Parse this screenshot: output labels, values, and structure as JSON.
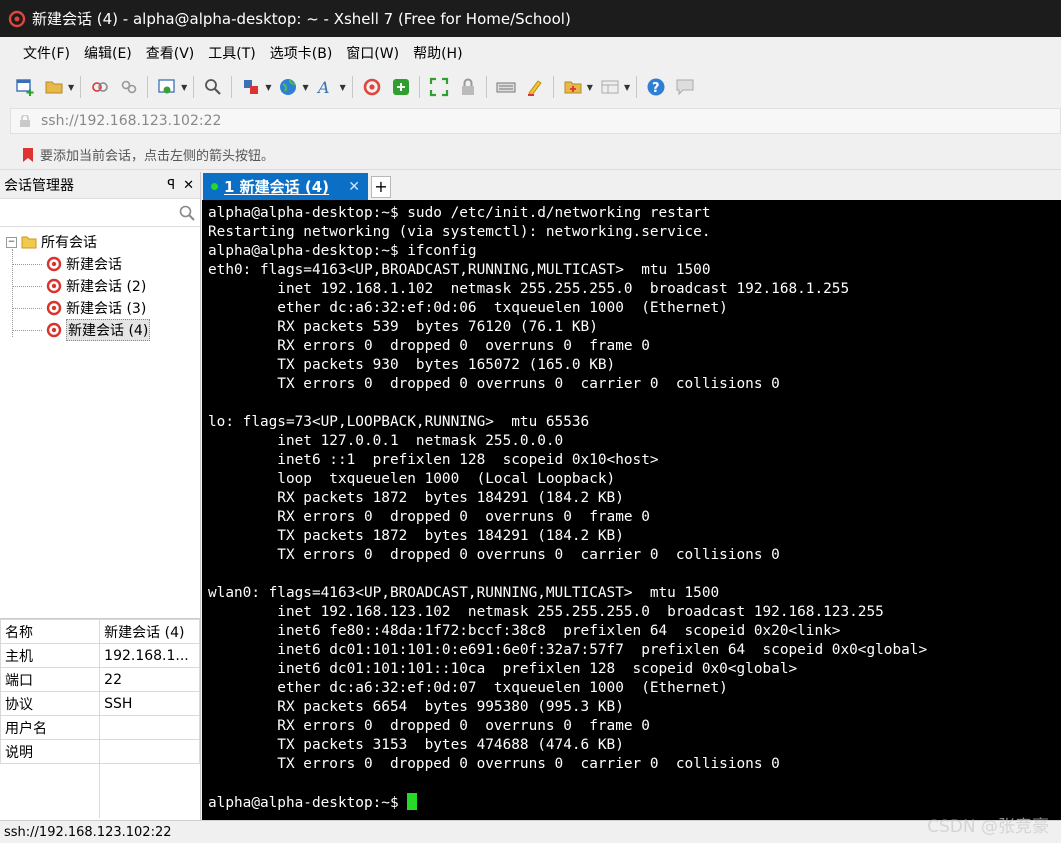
{
  "window": {
    "title": "新建会话 (4) - alpha@alpha-desktop: ~ - Xshell 7 (Free for Home/School)"
  },
  "menu": [
    "文件(F)",
    "编辑(E)",
    "查看(V)",
    "工具(T)",
    "选项卡(B)",
    "窗口(W)",
    "帮助(H)"
  ],
  "address": {
    "value": "ssh://192.168.123.102:22"
  },
  "hint": {
    "text": "要添加当前会话，点击左侧的箭头按钮。"
  },
  "session_manager": {
    "title": "会话管理器",
    "pin": "ꟼ",
    "close": "✕",
    "search_placeholder": "",
    "root": {
      "label": "所有会话",
      "expand": "−"
    },
    "items": [
      "新建会话",
      "新建会话 (2)",
      "新建会话 (3)",
      "新建会话 (4)"
    ]
  },
  "properties": [
    {
      "key": "名称",
      "value": "新建会话 (4)"
    },
    {
      "key": "主机",
      "value": "192.168.1..."
    },
    {
      "key": "端口",
      "value": "22"
    },
    {
      "key": "协议",
      "value": "SSH"
    },
    {
      "key": "用户名",
      "value": ""
    },
    {
      "key": "说明",
      "value": ""
    }
  ],
  "tabs": {
    "active": "1 新建会话 (4)",
    "close": "✕",
    "add": "+"
  },
  "terminal": {
    "lines": [
      "alpha@alpha-desktop:~$ sudo /etc/init.d/networking restart",
      "Restarting networking (via systemctl): networking.service.",
      "alpha@alpha-desktop:~$ ifconfig",
      "eth0: flags=4163<UP,BROADCAST,RUNNING,MULTICAST>  mtu 1500",
      "        inet 192.168.1.102  netmask 255.255.255.0  broadcast 192.168.1.255",
      "        ether dc:a6:32:ef:0d:06  txqueuelen 1000  (Ethernet)",
      "        RX packets 539  bytes 76120 (76.1 KB)",
      "        RX errors 0  dropped 0  overruns 0  frame 0",
      "        TX packets 930  bytes 165072 (165.0 KB)",
      "        TX errors 0  dropped 0 overruns 0  carrier 0  collisions 0",
      "",
      "lo: flags=73<UP,LOOPBACK,RUNNING>  mtu 65536",
      "        inet 127.0.0.1  netmask 255.0.0.0",
      "        inet6 ::1  prefixlen 128  scopeid 0x10<host>",
      "        loop  txqueuelen 1000  (Local Loopback)",
      "        RX packets 1872  bytes 184291 (184.2 KB)",
      "        RX errors 0  dropped 0  overruns 0  frame 0",
      "        TX packets 1872  bytes 184291 (184.2 KB)",
      "        TX errors 0  dropped 0 overruns 0  carrier 0  collisions 0",
      "",
      "wlan0: flags=4163<UP,BROADCAST,RUNNING,MULTICAST>  mtu 1500",
      "        inet 192.168.123.102  netmask 255.255.255.0  broadcast 192.168.123.255",
      "        inet6 fe80::48da:1f72:bccf:38c8  prefixlen 64  scopeid 0x20<link>",
      "        inet6 dc01:101:101:0:e691:6e0f:32a7:57f7  prefixlen 64  scopeid 0x0<global>",
      "        inet6 dc01:101:101::10ca  prefixlen 128  scopeid 0x0<global>",
      "        ether dc:a6:32:ef:0d:07  txqueuelen 1000  (Ethernet)",
      "        RX packets 6654  bytes 995380 (995.3 KB)",
      "        RX errors 0  dropped 0  overruns 0  frame 0",
      "        TX packets 3153  bytes 474688 (474.6 KB)",
      "        TX errors 0  dropped 0 overruns 0  carrier 0  collisions 0",
      ""
    ],
    "prompt": "alpha@alpha-desktop:~$ ",
    "cursor_color": "#27d927"
  },
  "status": {
    "text": "ssh://192.168.123.102:22"
  },
  "watermark": "CSDN @张竞豪",
  "colors": {
    "tab_active": "#0b6fc6",
    "terminal_bg": "#000000",
    "session_icon": "#d9342b"
  },
  "toolbar_icons": [
    "new-session-icon",
    "open-folder-icon",
    "reconnect-icon",
    "disconnect-icon",
    "properties-icon",
    "find-icon",
    "transfer-icon",
    "globe-icon",
    "font-icon",
    "xshell-icon",
    "xftp-icon",
    "fullscreen-icon",
    "lock-icon",
    "keyboard-icon",
    "highlight-icon",
    "compose-icon",
    "layout-icon",
    "help-icon",
    "chat-icon"
  ]
}
